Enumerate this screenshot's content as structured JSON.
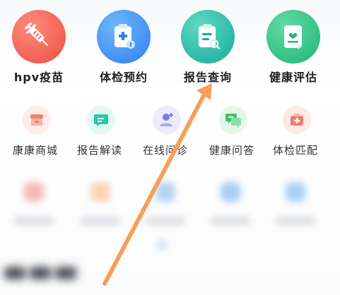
{
  "services": {
    "main": [
      {
        "label": "hpv疫苗",
        "icon": "vaccine-syringe-icon",
        "color": "#ef5b4b"
      },
      {
        "label": "体检预约",
        "icon": "clipboard-plus-icon",
        "color": "#3a8ef0"
      },
      {
        "label": "报告查询",
        "icon": "report-search-icon",
        "color": "#20b8a3"
      },
      {
        "label": "健康评估",
        "icon": "health-assessment-icon",
        "color": "#28c187"
      }
    ],
    "secondary": [
      {
        "label": "康康商城",
        "icon": "shop-icon",
        "color": "#f0836e"
      },
      {
        "label": "报告解读",
        "icon": "report-chat-icon",
        "color": "#2ec6a8"
      },
      {
        "label": "在线问诊",
        "icon": "doctor-consult-icon",
        "color": "#7f7cf2"
      },
      {
        "label": "健康问答",
        "icon": "qa-chat-icon",
        "color": "#3cc56d"
      },
      {
        "label": "体检匹配",
        "icon": "medical-kit-icon",
        "color": "#f07d72"
      }
    ]
  },
  "annotation": {
    "arrow_color": "#f5a05a",
    "points_to": "报告查询"
  }
}
